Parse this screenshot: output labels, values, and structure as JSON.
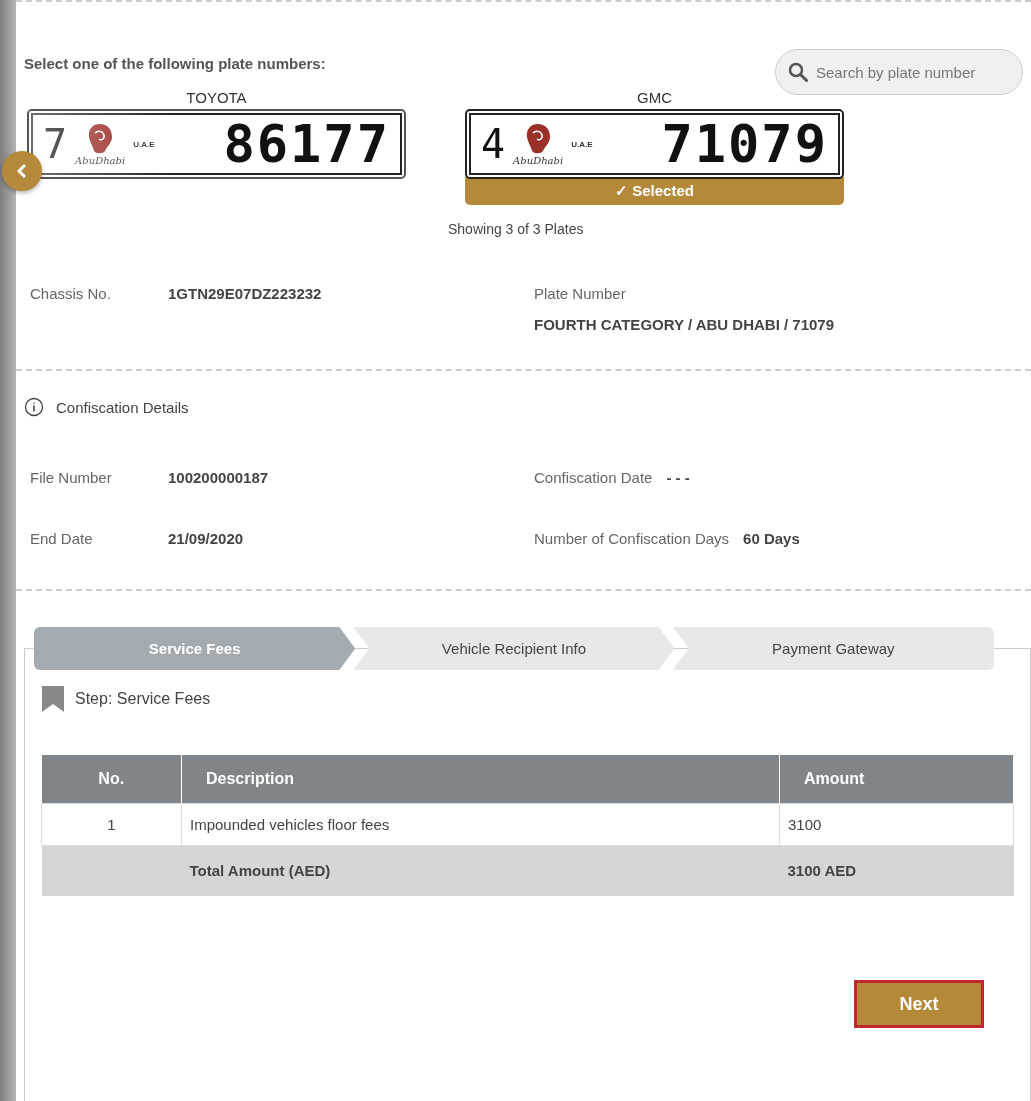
{
  "plate_picker": {
    "prompt": "Select one of the following plate numbers:",
    "search": {
      "placeholder": "Search by plate number"
    },
    "plates": [
      {
        "brand": "TOYOTA",
        "category": "7",
        "city": "AbuDhabi",
        "country": "U.A.E",
        "number": "86177",
        "selected": false
      },
      {
        "brand": "GMC",
        "category": "4",
        "city": "AbuDhabi",
        "country": "U.A.E",
        "number": "71079",
        "selected": true
      }
    ],
    "selected_label": "✓ Selected",
    "count": "Showing 3 of 3 Plates"
  },
  "vehicle": [
    {
      "label": "Chassis No.",
      "value": "1GTN29E07DZ223232"
    },
    {
      "label": "Plate Number",
      "value": "FOURTH CATEGORY / ABU DHABI / 71079"
    }
  ],
  "confiscation": {
    "title": "Confiscation Details",
    "fields": [
      {
        "label": "File Number",
        "value": "100200000187"
      },
      {
        "label": "Confiscation Date",
        "value": "- - -"
      },
      {
        "label": "End Date",
        "value": "21/09/2020"
      },
      {
        "label": "Number of Confiscation Days",
        "value": "60 Days"
      }
    ]
  },
  "steps": [
    {
      "label": "Service Fees",
      "selected": true
    },
    {
      "label": "Vehicle Recipient Info",
      "selected": false
    },
    {
      "label": "Payment Gateway",
      "selected": false
    }
  ],
  "step_title": "Step: Service Fees",
  "fees_table": {
    "columns": [
      "No.",
      "Description",
      "Amount"
    ],
    "rows": [
      [
        "1",
        "Impounded vehicles floor fees",
        "3100"
      ]
    ],
    "total": {
      "label": "Total Amount (AED)",
      "value": "3100 AED"
    }
  },
  "next_button": "Next"
}
